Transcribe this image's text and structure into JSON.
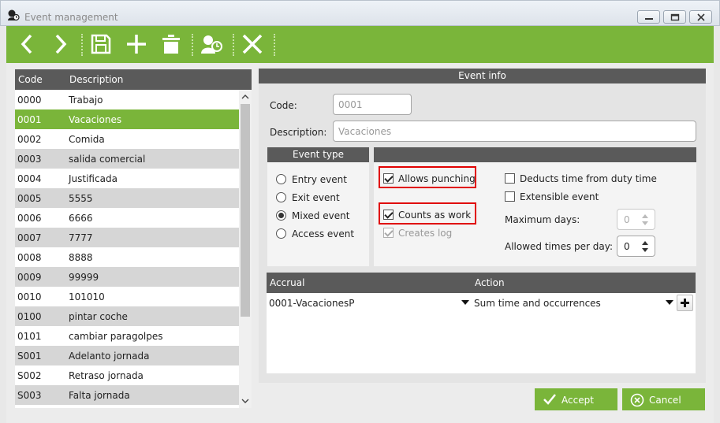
{
  "window": {
    "title": "Event management"
  },
  "toolbar": {
    "icons": [
      "chevron-left-icon",
      "chevron-right-icon",
      "save-icon",
      "plus-icon",
      "trash-icon",
      "user-clock-icon",
      "close-icon"
    ]
  },
  "list": {
    "headers": {
      "code": "Code",
      "description": "Description"
    },
    "rows": [
      {
        "code": "0000",
        "description": "Trabajo"
      },
      {
        "code": "0001",
        "description": "Vacaciones",
        "selected": true
      },
      {
        "code": "0002",
        "description": "Comida"
      },
      {
        "code": "0003",
        "description": "salida comercial"
      },
      {
        "code": "0004",
        "description": "Justificada"
      },
      {
        "code": "0005",
        "description": "5555"
      },
      {
        "code": "0006",
        "description": "6666"
      },
      {
        "code": "0007",
        "description": "7777"
      },
      {
        "code": "0008",
        "description": "8888"
      },
      {
        "code": "0009",
        "description": "99999"
      },
      {
        "code": "0010",
        "description": "101010"
      },
      {
        "code": "0100",
        "description": "pintar coche"
      },
      {
        "code": "0101",
        "description": "cambiar paragolpes"
      },
      {
        "code": "S001",
        "description": "Adelanto jornada"
      },
      {
        "code": "S002",
        "description": "Retraso jornada"
      },
      {
        "code": "S003",
        "description": "Falta jornada"
      }
    ]
  },
  "event_info": {
    "title": "Event info",
    "code_label": "Code:",
    "code_value": "0001",
    "description_label": "Description:",
    "description_value": "Vacaciones"
  },
  "event_type": {
    "title": "Event type",
    "options": [
      {
        "label": "Entry event",
        "checked": false
      },
      {
        "label": "Exit event",
        "checked": false
      },
      {
        "label": "Mixed event",
        "checked": true
      },
      {
        "label": "Access event",
        "checked": false
      }
    ]
  },
  "options": {
    "allows_punching": "Allows punching",
    "counts_as_work": "Counts as work",
    "creates_log": "Creates log",
    "deducts_time": "Deducts time from duty time",
    "extensible_event": "Extensible event",
    "maximum_days_label": "Maximum days:",
    "maximum_days_value": "0",
    "allowed_times_label": "Allowed times per day:",
    "allowed_times_value": "0",
    "highlight_color": "#e00000"
  },
  "accrual": {
    "col_accrual": "Accrual",
    "col_action": "Action",
    "accrual_value": "0001-VacacionesP",
    "action_value": "Sum time and occurrences"
  },
  "buttons": {
    "accept": "Accept",
    "cancel": "Cancel"
  },
  "colors": {
    "accent": "#7ab53a",
    "header": "#5a5a5a"
  }
}
